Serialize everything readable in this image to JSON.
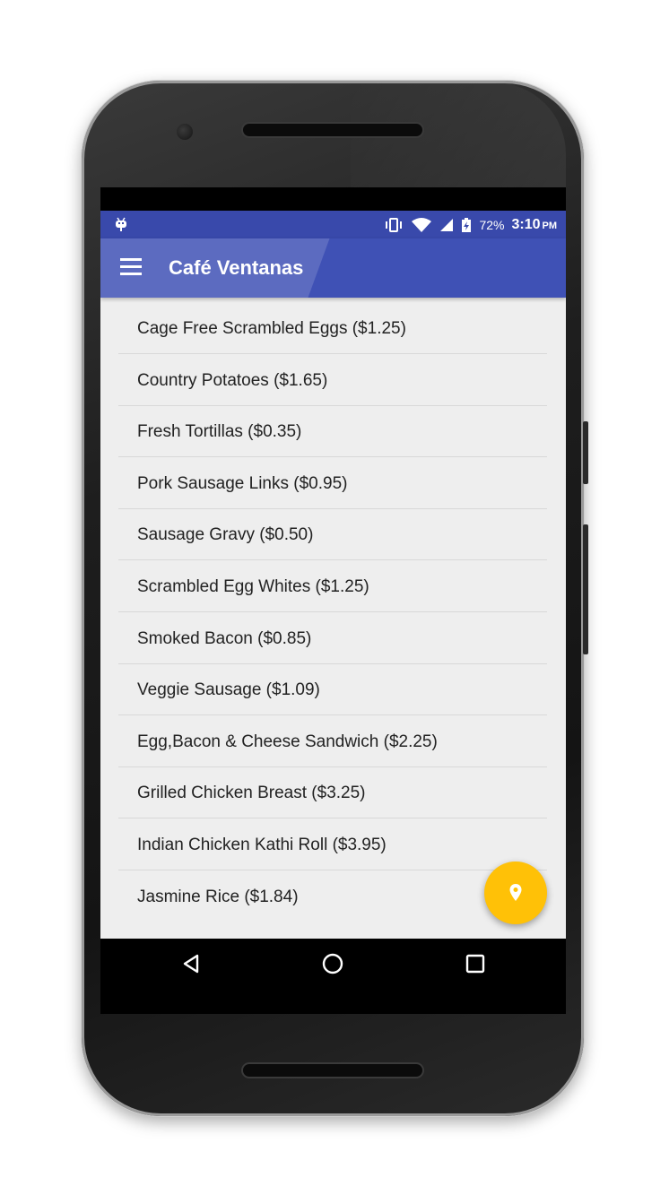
{
  "status_bar": {
    "battery": "72%",
    "time": "3:10",
    "ampm": "PM",
    "icons": [
      "debug-icon",
      "vibrate-icon",
      "wifi-icon",
      "signal-icon",
      "battery-charging-icon"
    ]
  },
  "app_bar": {
    "title": "Café Ventanas",
    "menu_icon": "hamburger-menu-icon",
    "color": "#3f51b5"
  },
  "menu_items": [
    {
      "label": "Cage Free Scrambled Eggs ($1.25)"
    },
    {
      "label": "Country Potatoes ($1.65)"
    },
    {
      "label": "Fresh Tortillas ($0.35)"
    },
    {
      "label": "Pork Sausage Links ($0.95)"
    },
    {
      "label": "Sausage Gravy ($0.50)"
    },
    {
      "label": "Scrambled Egg Whites ($1.25)"
    },
    {
      "label": "Smoked Bacon ($0.85)"
    },
    {
      "label": "Veggie Sausage ($1.09)"
    },
    {
      "label": "Egg,Bacon & Cheese Sandwich ($2.25)"
    },
    {
      "label": "Grilled Chicken Breast ($3.25)"
    },
    {
      "label": "Indian Chicken Kathi Roll ($3.95)"
    },
    {
      "label": "Jasmine Rice ($1.84)"
    }
  ],
  "fab": {
    "icon": "location-pin-icon",
    "color": "#ffc107"
  },
  "nav_bar": {
    "buttons": [
      "back-icon",
      "home-icon",
      "recents-icon"
    ]
  }
}
